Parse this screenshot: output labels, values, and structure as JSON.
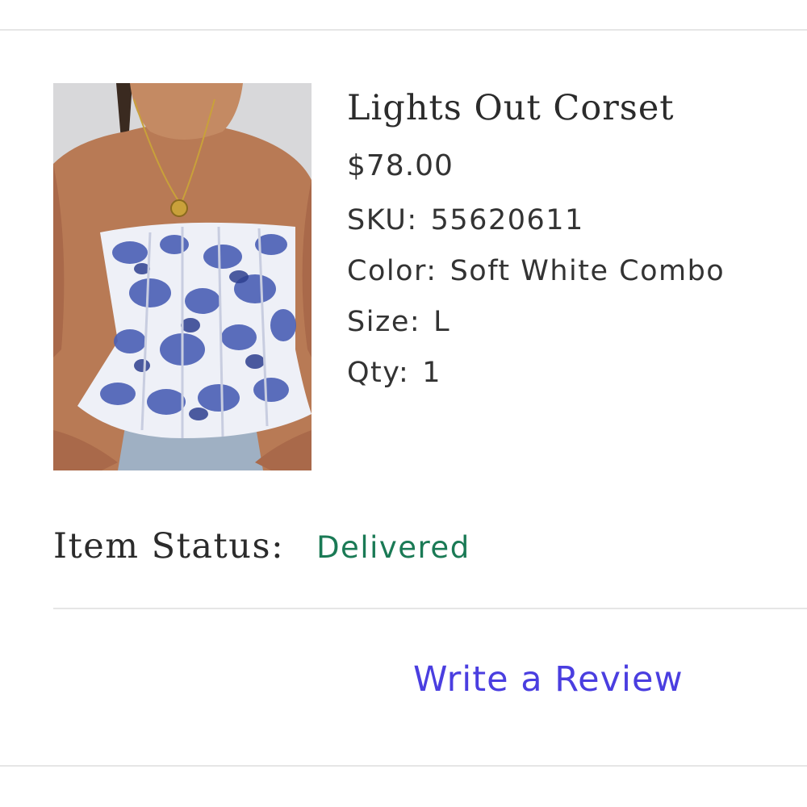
{
  "product": {
    "name": "Lights Out Corset",
    "price": "$78.00",
    "sku_label": "SKU:",
    "sku_value": "55620611",
    "color_label": "Color:",
    "color_value": "Soft White Combo",
    "size_label": "Size:",
    "size_value": "L",
    "qty_label": "Qty:",
    "qty_value": "1",
    "image_alt": "Lights Out Corset"
  },
  "status": {
    "label": "Item Status:",
    "value": "Delivered",
    "color": "#1a7a55"
  },
  "actions": {
    "review_label": "Write a Review",
    "link_color": "#4a3ee0"
  }
}
